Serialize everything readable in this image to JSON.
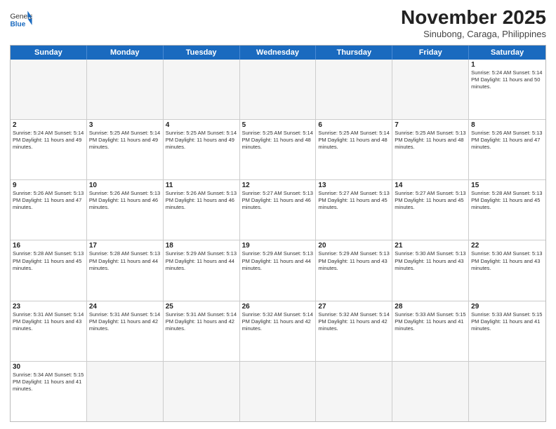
{
  "header": {
    "logo_general": "General",
    "logo_blue": "Blue",
    "month_title": "November 2025",
    "location": "Sinubong, Caraga, Philippines"
  },
  "weekdays": [
    "Sunday",
    "Monday",
    "Tuesday",
    "Wednesday",
    "Thursday",
    "Friday",
    "Saturday"
  ],
  "weeks": [
    [
      {
        "day": "",
        "info": ""
      },
      {
        "day": "",
        "info": ""
      },
      {
        "day": "",
        "info": ""
      },
      {
        "day": "",
        "info": ""
      },
      {
        "day": "",
        "info": ""
      },
      {
        "day": "",
        "info": ""
      },
      {
        "day": "1",
        "info": "Sunrise: 5:24 AM\nSunset: 5:14 PM\nDaylight: 11 hours\nand 50 minutes."
      }
    ],
    [
      {
        "day": "2",
        "info": "Sunrise: 5:24 AM\nSunset: 5:14 PM\nDaylight: 11 hours\nand 49 minutes."
      },
      {
        "day": "3",
        "info": "Sunrise: 5:25 AM\nSunset: 5:14 PM\nDaylight: 11 hours\nand 49 minutes."
      },
      {
        "day": "4",
        "info": "Sunrise: 5:25 AM\nSunset: 5:14 PM\nDaylight: 11 hours\nand 49 minutes."
      },
      {
        "day": "5",
        "info": "Sunrise: 5:25 AM\nSunset: 5:14 PM\nDaylight: 11 hours\nand 48 minutes."
      },
      {
        "day": "6",
        "info": "Sunrise: 5:25 AM\nSunset: 5:14 PM\nDaylight: 11 hours\nand 48 minutes."
      },
      {
        "day": "7",
        "info": "Sunrise: 5:25 AM\nSunset: 5:13 PM\nDaylight: 11 hours\nand 48 minutes."
      },
      {
        "day": "8",
        "info": "Sunrise: 5:26 AM\nSunset: 5:13 PM\nDaylight: 11 hours\nand 47 minutes."
      }
    ],
    [
      {
        "day": "9",
        "info": "Sunrise: 5:26 AM\nSunset: 5:13 PM\nDaylight: 11 hours\nand 47 minutes."
      },
      {
        "day": "10",
        "info": "Sunrise: 5:26 AM\nSunset: 5:13 PM\nDaylight: 11 hours\nand 46 minutes."
      },
      {
        "day": "11",
        "info": "Sunrise: 5:26 AM\nSunset: 5:13 PM\nDaylight: 11 hours\nand 46 minutes."
      },
      {
        "day": "12",
        "info": "Sunrise: 5:27 AM\nSunset: 5:13 PM\nDaylight: 11 hours\nand 46 minutes."
      },
      {
        "day": "13",
        "info": "Sunrise: 5:27 AM\nSunset: 5:13 PM\nDaylight: 11 hours\nand 45 minutes."
      },
      {
        "day": "14",
        "info": "Sunrise: 5:27 AM\nSunset: 5:13 PM\nDaylight: 11 hours\nand 45 minutes."
      },
      {
        "day": "15",
        "info": "Sunrise: 5:28 AM\nSunset: 5:13 PM\nDaylight: 11 hours\nand 45 minutes."
      }
    ],
    [
      {
        "day": "16",
        "info": "Sunrise: 5:28 AM\nSunset: 5:13 PM\nDaylight: 11 hours\nand 45 minutes."
      },
      {
        "day": "17",
        "info": "Sunrise: 5:28 AM\nSunset: 5:13 PM\nDaylight: 11 hours\nand 44 minutes."
      },
      {
        "day": "18",
        "info": "Sunrise: 5:29 AM\nSunset: 5:13 PM\nDaylight: 11 hours\nand 44 minutes."
      },
      {
        "day": "19",
        "info": "Sunrise: 5:29 AM\nSunset: 5:13 PM\nDaylight: 11 hours\nand 44 minutes."
      },
      {
        "day": "20",
        "info": "Sunrise: 5:29 AM\nSunset: 5:13 PM\nDaylight: 11 hours\nand 43 minutes."
      },
      {
        "day": "21",
        "info": "Sunrise: 5:30 AM\nSunset: 5:13 PM\nDaylight: 11 hours\nand 43 minutes."
      },
      {
        "day": "22",
        "info": "Sunrise: 5:30 AM\nSunset: 5:13 PM\nDaylight: 11 hours\nand 43 minutes."
      }
    ],
    [
      {
        "day": "23",
        "info": "Sunrise: 5:31 AM\nSunset: 5:14 PM\nDaylight: 11 hours\nand 43 minutes."
      },
      {
        "day": "24",
        "info": "Sunrise: 5:31 AM\nSunset: 5:14 PM\nDaylight: 11 hours\nand 42 minutes."
      },
      {
        "day": "25",
        "info": "Sunrise: 5:31 AM\nSunset: 5:14 PM\nDaylight: 11 hours\nand 42 minutes."
      },
      {
        "day": "26",
        "info": "Sunrise: 5:32 AM\nSunset: 5:14 PM\nDaylight: 11 hours\nand 42 minutes."
      },
      {
        "day": "27",
        "info": "Sunrise: 5:32 AM\nSunset: 5:14 PM\nDaylight: 11 hours\nand 42 minutes."
      },
      {
        "day": "28",
        "info": "Sunrise: 5:33 AM\nSunset: 5:15 PM\nDaylight: 11 hours\nand 41 minutes."
      },
      {
        "day": "29",
        "info": "Sunrise: 5:33 AM\nSunset: 5:15 PM\nDaylight: 11 hours\nand 41 minutes."
      }
    ],
    [
      {
        "day": "30",
        "info": "Sunrise: 5:34 AM\nSunset: 5:15 PM\nDaylight: 11 hours\nand 41 minutes."
      },
      {
        "day": "",
        "info": ""
      },
      {
        "day": "",
        "info": ""
      },
      {
        "day": "",
        "info": ""
      },
      {
        "day": "",
        "info": ""
      },
      {
        "day": "",
        "info": ""
      },
      {
        "day": "",
        "info": ""
      }
    ]
  ]
}
